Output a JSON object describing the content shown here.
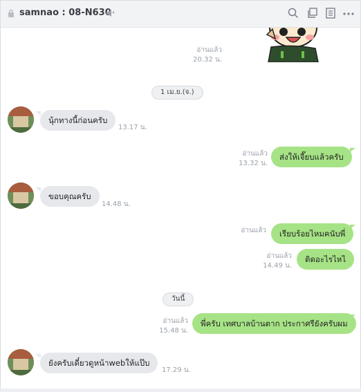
{
  "header": {
    "title": "samnao : 08-N630",
    "icons": [
      "lock-icon",
      "speaker-mute-icon",
      "search-icon",
      "copy-icon",
      "notes-icon",
      "more-icon"
    ]
  },
  "messages": {
    "sticker_read": "อ่านแล้ว",
    "sticker_time": "20.32 น.",
    "date1": "1 เม.ย.(จ.)",
    "m1_text": "นุ้กทางนี้ก่อนครับ",
    "m1_time": "13.17 น.",
    "m2_read": "อ่านแล้ว",
    "m2_time": "13.32 น.",
    "m2_text": "ส่งให้เจี๊ยบแล้วครับ",
    "m3_text": "ขอบคุณครับ",
    "m3_time": "14.48 น.",
    "m4_read": "อ่านแล้ว",
    "m4_text": "เรียบร้อยไหมคนับพี่",
    "m5_read": "อ่านแล้ว",
    "m5_time": "14.49 น.",
    "m5_text": "ติดอะไรไหไ",
    "date2": "วันนี้",
    "m6_read": "อ่านแล้ว",
    "m6_time": "15.48 น.",
    "m6_text": "พี่ครับ เทศบาลบ้านตาก ประกาศรียังครับผม",
    "m7_text": "ยังครับเดี๋ยวดูหน้าwebให้แป๊บ",
    "m7_time": "17.29 น."
  },
  "colors": {
    "outgoing_bubble": "#a6e386",
    "incoming_bubble": "#e6e8ec",
    "header_bg": "#f2f3f5"
  }
}
